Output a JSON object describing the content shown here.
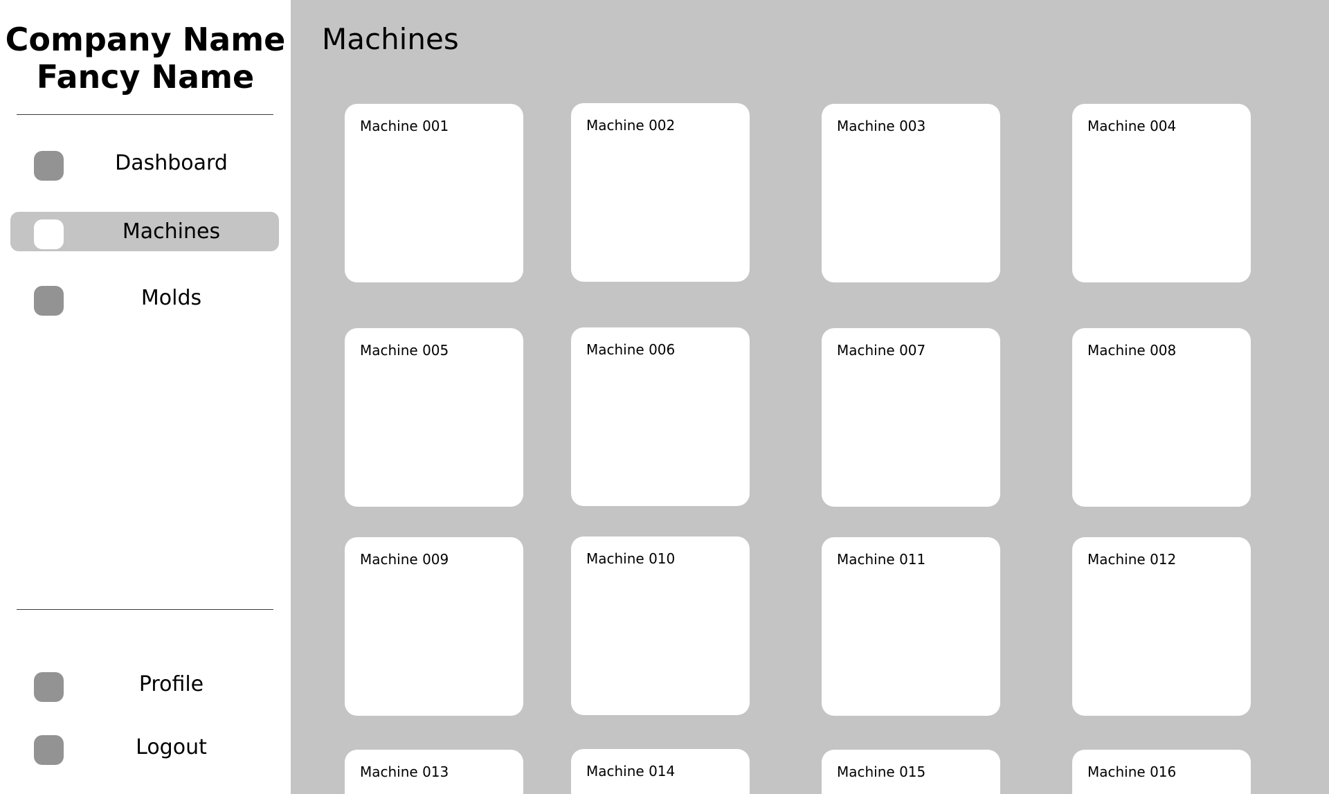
{
  "brand": {
    "line1": "Company Name",
    "line2": "Fancy Name"
  },
  "sidebar": {
    "nav": [
      {
        "label": "Dashboard",
        "icon": "dashboard-icon",
        "active": false
      },
      {
        "label": "Machines",
        "icon": "machines-icon",
        "active": true
      },
      {
        "label": "Molds",
        "icon": "molds-icon",
        "active": false
      }
    ],
    "footer": [
      {
        "label": "Profile",
        "icon": "profile-icon"
      },
      {
        "label": "Logout",
        "icon": "logout-icon"
      }
    ]
  },
  "main": {
    "title": "Machines",
    "machines": [
      {
        "label": "Machine 001"
      },
      {
        "label": "Machine 002"
      },
      {
        "label": "Machine 003"
      },
      {
        "label": "Machine 004"
      },
      {
        "label": "Machine 005"
      },
      {
        "label": "Machine 006"
      },
      {
        "label": "Machine 007"
      },
      {
        "label": "Machine 008"
      },
      {
        "label": "Machine 009"
      },
      {
        "label": "Machine 010"
      },
      {
        "label": "Machine 011"
      },
      {
        "label": "Machine 012"
      },
      {
        "label": "Machine 013"
      },
      {
        "label": "Machine 014"
      },
      {
        "label": "Machine 015"
      },
      {
        "label": "Machine 016"
      }
    ]
  },
  "colors": {
    "background": "#c4c4c4",
    "sidebar": "#ffffff",
    "card": "#ffffff",
    "icon": "#939393",
    "active_item": "#c4c4c4"
  }
}
